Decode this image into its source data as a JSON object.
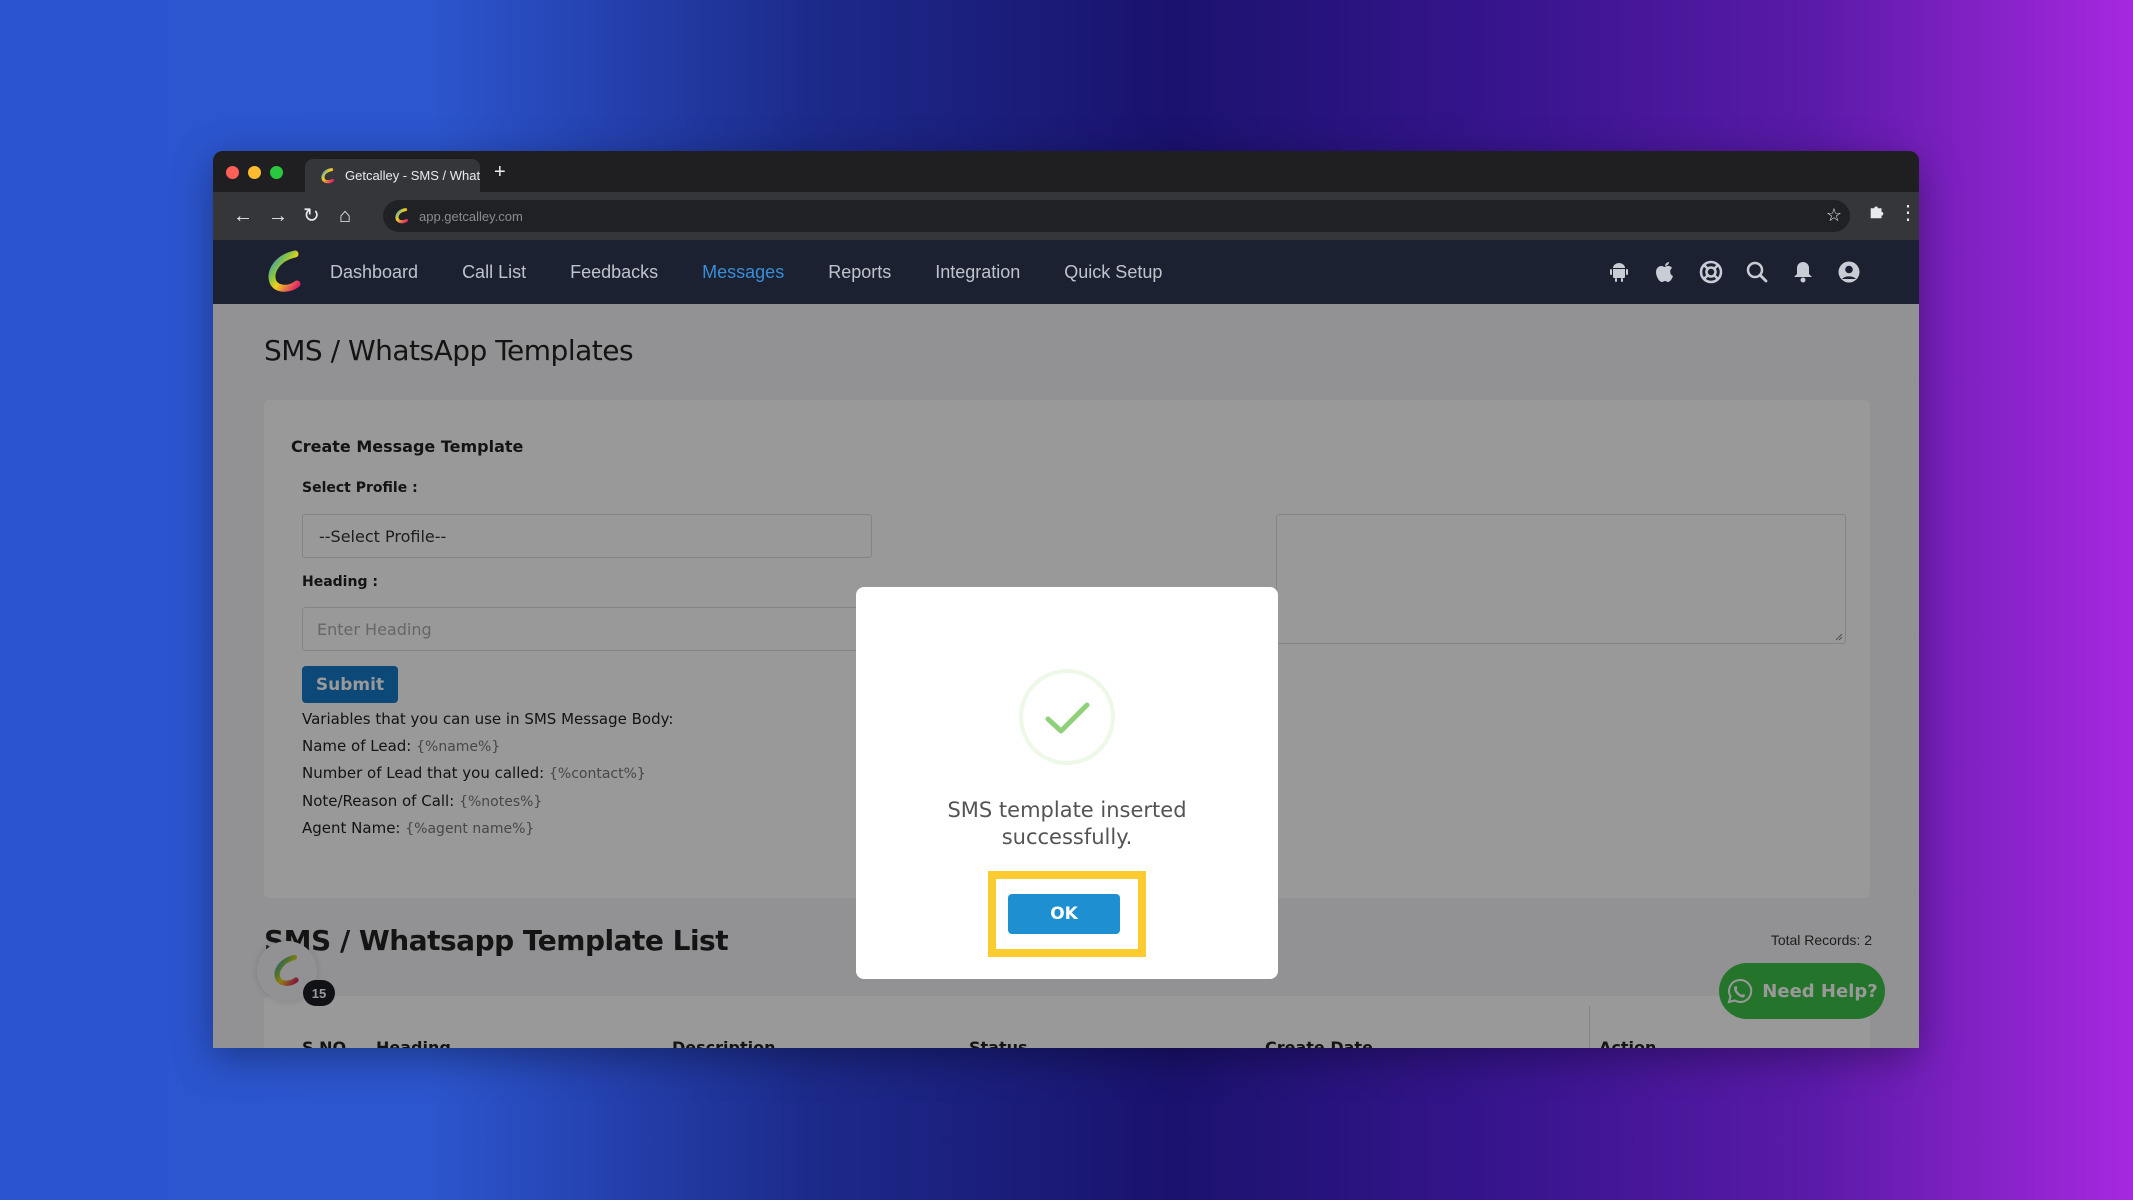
{
  "browser": {
    "tab_title": "Getcalley - SMS / Whatsapp Temp",
    "new_tab": "+",
    "url": "app.getcalley.com"
  },
  "nav": {
    "items": [
      {
        "label": "Dashboard",
        "active": false
      },
      {
        "label": "Call List",
        "active": false
      },
      {
        "label": "Feedbacks",
        "active": false
      },
      {
        "label": "Messages",
        "active": true
      },
      {
        "label": "Reports",
        "active": false
      },
      {
        "label": "Integration",
        "active": false
      },
      {
        "label": "Quick Setup",
        "active": false
      }
    ],
    "icons": [
      "android-icon",
      "apple-icon",
      "support-icon",
      "search-icon",
      "bell-icon",
      "user-icon"
    ]
  },
  "page": {
    "title": "SMS / WhatsApp Templates"
  },
  "form": {
    "title": "Create Message Template",
    "profile_label": "Select Profile :",
    "profile_value": "--Select Profile--",
    "heading_label": "Heading :",
    "heading_placeholder": "Enter Heading",
    "submit_label": "Submit",
    "variables_intro": "Variables that you can use in SMS Message Body:",
    "variables": [
      {
        "label": "Name of Lead:",
        "code": "{%name%}"
      },
      {
        "label": "Number of Lead that you called:",
        "code": "{%contact%}"
      },
      {
        "label": "Note/Reason of Call:",
        "code": "{%notes%}"
      },
      {
        "label": "Agent Name:",
        "code": "{%agent name%}"
      }
    ]
  },
  "list": {
    "title": "SMS / Whatsapp Template List",
    "total_records": "Total Records: 2",
    "columns": [
      "S NO.",
      "Heading",
      "Description",
      "Status",
      "Create Date",
      "Action"
    ]
  },
  "widgets": {
    "notification_badge": "15",
    "need_help_label": "Need Help?"
  },
  "modal": {
    "message": "SMS template inserted successfully.",
    "ok_label": "OK",
    "icon": "success-check-icon"
  },
  "colors": {
    "accent": "#1e8fd0",
    "nav_active": "#3a8ed6",
    "success": "#a5dc86",
    "highlight": "#fbcb2f",
    "whatsapp": "#3fc24a"
  }
}
